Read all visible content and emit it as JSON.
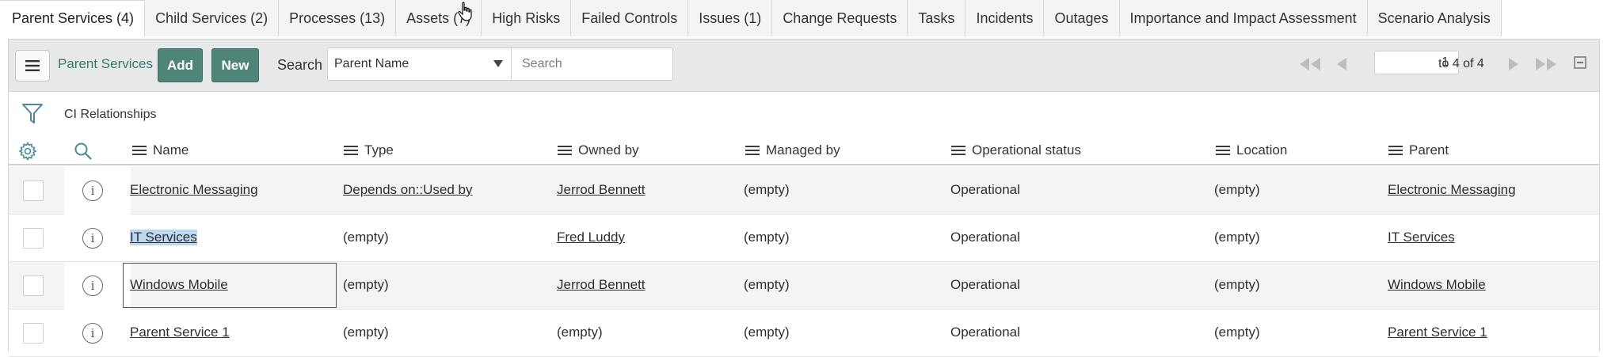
{
  "tabs": [
    {
      "label": "Parent Services (4)",
      "active": true
    },
    {
      "label": "Child Services (2)"
    },
    {
      "label": "Processes (13)"
    },
    {
      "label": "Assets (7)"
    },
    {
      "label": "High Risks"
    },
    {
      "label": "Failed Controls"
    },
    {
      "label": "Issues (1)"
    },
    {
      "label": "Change Requests"
    },
    {
      "label": "Tasks"
    },
    {
      "label": "Incidents"
    },
    {
      "label": "Outages"
    },
    {
      "label": "Importance and Impact Assessment"
    },
    {
      "label": "Scenario Analysis"
    }
  ],
  "toolbar": {
    "list_title": "Parent Services",
    "add_label": "Add",
    "new_label": "New",
    "search_label": "Search",
    "search_field": "Parent Name",
    "search_placeholder": "Search",
    "page_value": "1",
    "page_of": "to 4 of 4"
  },
  "filter": {
    "label": "CI Relationships"
  },
  "columns": [
    "Name",
    "Type",
    "Owned by",
    "Managed by",
    "Operational status",
    "Location",
    "Parent"
  ],
  "rows": [
    {
      "name": "Electronic Messaging",
      "type": "Depends on::Used by",
      "owned_by": "Jerrod Bennett",
      "managed_by": "(empty)",
      "status": "Operational",
      "location": "(empty)",
      "parent": "Electronic Messaging"
    },
    {
      "name": "IT Services",
      "type": "(empty)",
      "owned_by": "Fred Luddy",
      "managed_by": "(empty)",
      "status": "Operational",
      "location": "(empty)",
      "parent": "IT Services"
    },
    {
      "name": "Windows Mobile",
      "type": "(empty)",
      "owned_by": "Jerrod Bennett",
      "managed_by": "(empty)",
      "status": "Operational",
      "location": "(empty)",
      "parent": "Windows Mobile"
    },
    {
      "name": "Parent Service 1",
      "type": "(empty)",
      "owned_by": "(empty)",
      "managed_by": "(empty)",
      "status": "Operational",
      "location": "(empty)",
      "parent": "Parent Service 1"
    }
  ],
  "icons": {
    "menu": "hamburger-icon",
    "filter": "funnel-icon",
    "settings": "gear-icon",
    "search": "magnifier-icon",
    "row_info": "info-circle-icon"
  },
  "colors": {
    "accent": "#4f8479",
    "title_accent": "#3a7a6e",
    "selection_highlight": "#bcd7f0"
  }
}
